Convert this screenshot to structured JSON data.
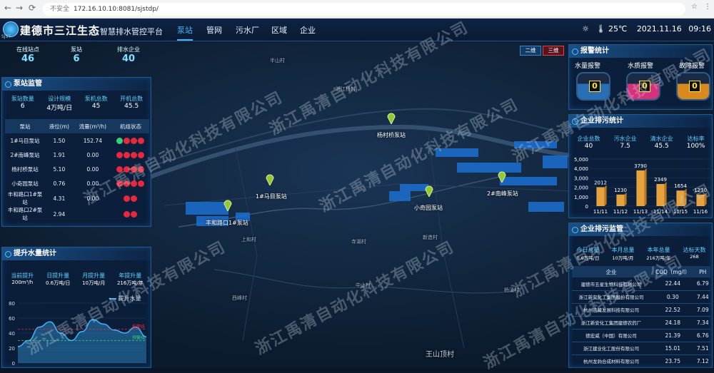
{
  "browser": {
    "url": "172.16.10.10:8081/sjstdp/",
    "security": "不安全"
  },
  "header": {
    "logo_text": "SJST",
    "title": "建德市三江生态",
    "subtitle": "智慧排水管控平台",
    "nav": [
      "泵站",
      "管网",
      "污水厂",
      "区域",
      "企业"
    ],
    "temperature": "25℃",
    "date": "2021.11.16",
    "time": "09:16"
  },
  "top_stats": [
    {
      "label": "在线站点",
      "value": "46"
    },
    {
      "label": "泵站",
      "value": "6"
    },
    {
      "label": "排水企业",
      "value": "40"
    }
  ],
  "map_buttons": {
    "two_d": "二维",
    "three_d": "三维"
  },
  "pump": {
    "title": "泵站监管",
    "stats": [
      {
        "label": "泵站数量",
        "value": "6"
      },
      {
        "label": "设计规模",
        "value": "4万吨/日"
      },
      {
        "label": "泵机总数",
        "value": "45"
      },
      {
        "label": "开机总数",
        "value": "45.5"
      }
    ],
    "headers": [
      "泵站",
      "液位(m)",
      "流量(m³/h)",
      "机组状态"
    ],
    "rows": [
      [
        "1#马目泵站",
        "1.50",
        "152.74"
      ],
      [
        "2#南峰泵站",
        "1.91",
        "0.00"
      ],
      [
        "杨村桥泵站",
        "5.10",
        "0.00"
      ],
      [
        "小奇园泵站",
        "0.76",
        "0.00"
      ],
      [
        "丰和路口1#泵站",
        "4.31",
        "0.00"
      ],
      [
        "丰和路口2#泵站",
        "2.94",
        ""
      ]
    ],
    "states": [
      [
        "g",
        "r",
        "r",
        "r"
      ],
      [
        "r",
        "r",
        "r",
        "r"
      ],
      [
        "r",
        "r",
        "r",
        "r"
      ],
      [
        "r",
        "r",
        "r",
        "r"
      ],
      [
        "r",
        "r"
      ],
      [
        "r",
        "r"
      ]
    ],
    "colors": {
      "g": "#33d17a",
      "r": "#e8283c"
    }
  },
  "water": {
    "title": "提升水量统计",
    "stats": [
      {
        "label": "当前提升",
        "value": "200m³/h"
      },
      {
        "label": "日提升量",
        "value": "0.6万吨/日"
      },
      {
        "label": "月提升量",
        "value": "10万吨/月"
      },
      {
        "label": "年提升量",
        "value": "216万吨/年"
      }
    ],
    "legend": "提升水量",
    "warn_hi": "报警线",
    "warn_lo": "预警线"
  },
  "alarm": {
    "title": "报警统计",
    "items": [
      {
        "label": "水量报警",
        "value": "0",
        "color": "#2a6fb5"
      },
      {
        "label": "水质报警",
        "value": "0",
        "color": "#d6317b"
      },
      {
        "label": "故障报警",
        "value": "0",
        "color": "#d98a1f"
      }
    ]
  },
  "ent_stat": {
    "title": "企业排污统计",
    "stats": [
      {
        "label": "企业总数",
        "value": "40"
      },
      {
        "label": "污水企业",
        "value": "7.5"
      },
      {
        "label": "清水企业",
        "value": "45.5"
      },
      {
        "label": "达标率",
        "value": "100%"
      }
    ]
  },
  "ent_sup": {
    "title": "企业排污监管",
    "stats": [
      {
        "label": "今日总量",
        "value": "0.6万吨/日"
      },
      {
        "label": "本月总量",
        "value": "10万吨/月"
      },
      {
        "label": "本年总量",
        "value": "216万吨/年"
      },
      {
        "label": "达标天数",
        "value": "268"
      }
    ],
    "headers": [
      "企业",
      "COD（mg/l）",
      "PH"
    ],
    "rows": [
      [
        "建德市五星生物科技有限公司",
        "22.44",
        "6.79"
      ],
      [
        "浙江新安化工集团股份有限公司",
        "0.30",
        "7.44"
      ],
      [
        "杭州志藏发展科技有限公司",
        "22.52",
        "7.09"
      ],
      [
        "浙江新安化工集团建德农药厂",
        "24.18",
        "7.34"
      ],
      [
        "德宏威（中国）有限公司",
        "21.39",
        "6.76"
      ],
      [
        "浙江建业化工股份有限公司",
        "15.01",
        "7.51"
      ],
      [
        "杭州龙驹合成材料有限公司",
        "23.75",
        "7.12"
      ]
    ]
  },
  "map_labels": {
    "stations": [
      "杨村桥泵站",
      "1#马目泵站",
      "2#南峰泵站",
      "小奇园泵站",
      "丰和路口1#泵站"
    ],
    "place": [
      "半山村",
      "浙江桥村",
      "西峰村",
      "上和村",
      "中山村",
      "王山顶村",
      "新造村",
      "寺湖村",
      "杨溪村"
    ]
  },
  "watermark": "浙江禹清自动化科技有限公司",
  "chart_data": [
    {
      "type": "area",
      "x": [
        0,
        1,
        2,
        3,
        4,
        5,
        6,
        7,
        8,
        9,
        10,
        11,
        12
      ],
      "values": [
        22,
        30,
        48,
        55,
        40,
        30,
        42,
        58,
        52,
        44,
        40,
        48,
        35
      ],
      "ylim": [
        0,
        80
      ],
      "yticks": [
        0,
        20,
        40,
        60,
        80
      ],
      "series": [
        {
          "name": "提升水量"
        }
      ],
      "warn_hi": 45,
      "warn_lo": 30
    },
    {
      "type": "bar",
      "categories": [
        "11/11",
        "11/12",
        "11/13",
        "11/14",
        "11/15",
        "11/16"
      ],
      "values": [
        2012,
        1230,
        3790,
        2349,
        1654,
        1230
      ],
      "ylim": [
        0,
        5000
      ],
      "yticks": [
        0,
        1000,
        2000,
        3000,
        4000,
        5000
      ]
    }
  ]
}
